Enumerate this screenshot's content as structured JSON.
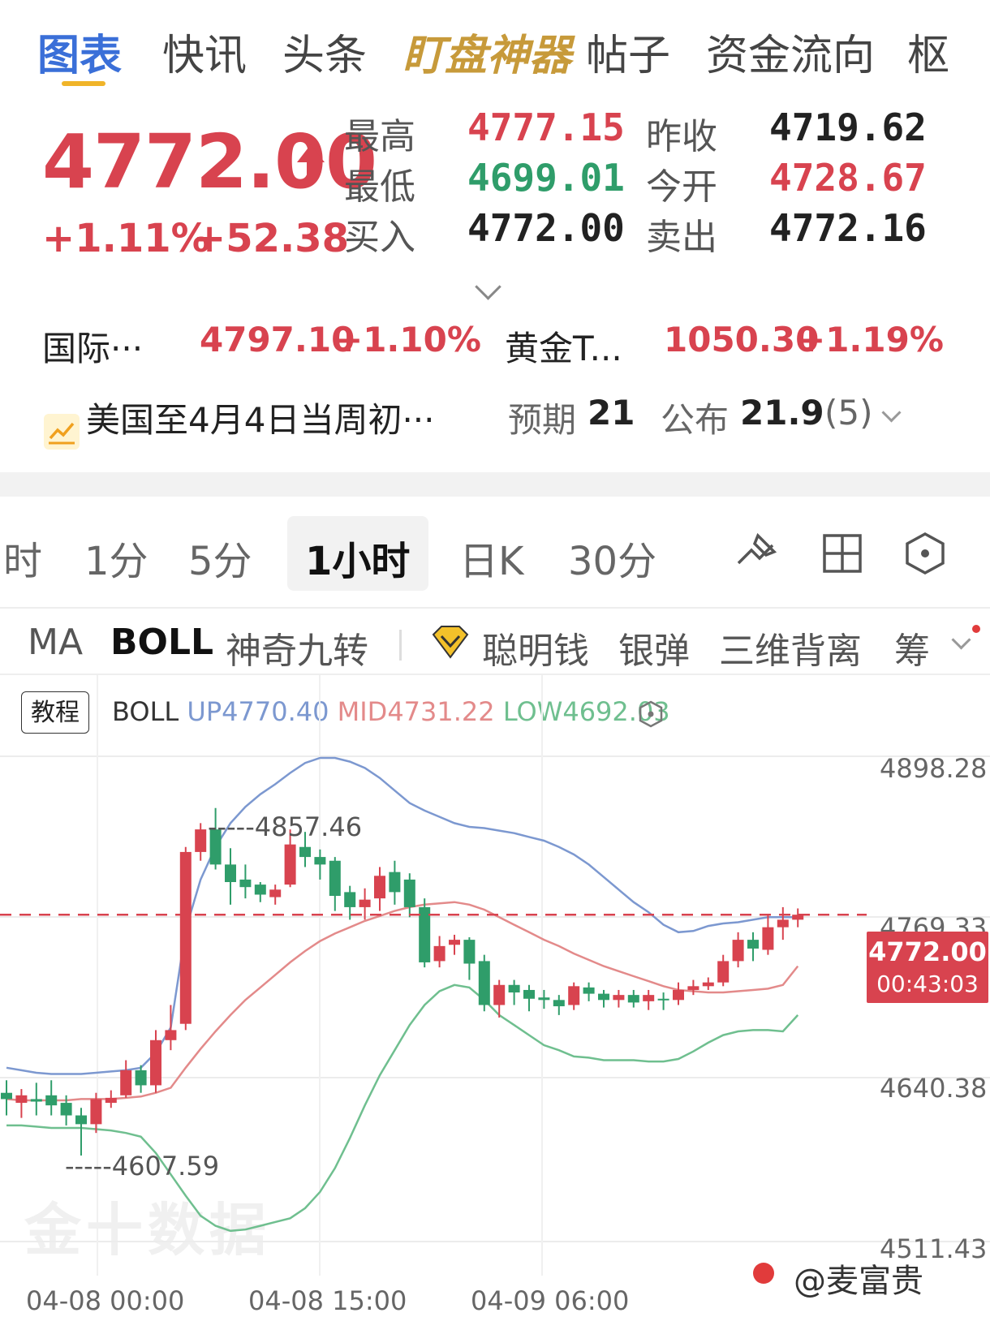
{
  "top_tabs": [
    "图表",
    "快讯",
    "头条",
    "盯盘神器",
    "帖子",
    "资金流向",
    "枢"
  ],
  "quote": {
    "price": "4772.00",
    "pct": "+1.11%",
    "change": "+52.38",
    "high_label": "最高",
    "high": "4777.15",
    "low_label": "最低",
    "low": "4699.01",
    "bid_label": "买入",
    "bid": "4772.00",
    "prev_close_label": "昨收",
    "prev_close": "4719.62",
    "open_label": "今开",
    "open": "4728.67",
    "ask_label": "卖出",
    "ask": "4772.16"
  },
  "related": {
    "a_name": "国际···",
    "a_price": "4797.10",
    "a_pct": "+1.10%",
    "b_name": "黄金T...",
    "b_price": "1050.30",
    "b_pct": "+1.19%"
  },
  "event": {
    "title": "美国至4月4日当周初···",
    "expected_label": "预期",
    "expected": "21",
    "actual_label": "公布",
    "actual": "21.9",
    "count": "(5)"
  },
  "intervals": [
    "时",
    "1分",
    "5分",
    "1小时",
    "日K",
    "30分"
  ],
  "interval_active": "1小时",
  "indicators": [
    "MA",
    "BOLL",
    "神奇九转",
    "聪明钱",
    "银弹",
    "三维背离",
    "筹"
  ],
  "chart": {
    "tutorial": "教程",
    "legend_name": "BOLL",
    "up": "UP4770.40",
    "mid": "MID4731.22",
    "low": "LOW4692.03",
    "y_ticks": [
      "4898.28",
      "4769.33",
      "4640.38",
      "4511.43"
    ],
    "max_label": "4857.46",
    "min_label": "4607.59",
    "current_price": "4772.00",
    "countdown": "00:43:03",
    "x_ticks": [
      "04-08 00:00",
      "04-08 15:00",
      "04-09 06:00"
    ],
    "watermark": "金十数据",
    "credit": "@麦富贵",
    "colors": {
      "up": "#d8434f",
      "down": "#2f9d6a",
      "upper_band": "#7c98d0",
      "mid_band": "#e38a8a",
      "lower_band": "#6fbf8f"
    }
  },
  "chart_data": {
    "type": "candlestick",
    "y_range": [
      4480,
      4930
    ],
    "candles": [
      {
        "o": 4630,
        "c": 4625,
        "h": 4640,
        "l": 4612
      },
      {
        "o": 4622,
        "c": 4628,
        "h": 4633,
        "l": 4610
      },
      {
        "o": 4625,
        "c": 4623,
        "h": 4638,
        "l": 4612
      },
      {
        "o": 4628,
        "c": 4620,
        "h": 4640,
        "l": 4612
      },
      {
        "o": 4622,
        "c": 4612,
        "h": 4628,
        "l": 4604
      },
      {
        "o": 4612,
        "c": 4605,
        "h": 4618,
        "l": 4580
      },
      {
        "o": 4605,
        "c": 4625,
        "h": 4630,
        "l": 4598
      },
      {
        "o": 4622,
        "c": 4626,
        "h": 4632,
        "l": 4618
      },
      {
        "o": 4628,
        "c": 4648,
        "h": 4656,
        "l": 4626
      },
      {
        "o": 4648,
        "c": 4636,
        "h": 4652,
        "l": 4630
      },
      {
        "o": 4636,
        "c": 4672,
        "h": 4680,
        "l": 4630
      },
      {
        "o": 4672,
        "c": 4680,
        "h": 4700,
        "l": 4664
      },
      {
        "o": 4685,
        "c": 4822,
        "h": 4826,
        "l": 4680
      },
      {
        "o": 4822,
        "c": 4840,
        "h": 4845,
        "l": 4815
      },
      {
        "o": 4840,
        "c": 4812,
        "h": 4857,
        "l": 4808
      },
      {
        "o": 4812,
        "c": 4798,
        "h": 4825,
        "l": 4780
      },
      {
        "o": 4800,
        "c": 4794,
        "h": 4812,
        "l": 4785
      },
      {
        "o": 4796,
        "c": 4788,
        "h": 4798,
        "l": 4782
      },
      {
        "o": 4786,
        "c": 4792,
        "h": 4796,
        "l": 4780
      },
      {
        "o": 4796,
        "c": 4828,
        "h": 4840,
        "l": 4794
      },
      {
        "o": 4826,
        "c": 4818,
        "h": 4838,
        "l": 4810
      },
      {
        "o": 4818,
        "c": 4812,
        "h": 4824,
        "l": 4800
      },
      {
        "o": 4815,
        "c": 4787,
        "h": 4818,
        "l": 4775
      },
      {
        "o": 4790,
        "c": 4778,
        "h": 4795,
        "l": 4768
      },
      {
        "o": 4778,
        "c": 4784,
        "h": 4793,
        "l": 4768
      },
      {
        "o": 4785,
        "c": 4803,
        "h": 4810,
        "l": 4775
      },
      {
        "o": 4806,
        "c": 4790,
        "h": 4815,
        "l": 4780
      },
      {
        "o": 4800,
        "c": 4778,
        "h": 4805,
        "l": 4770
      },
      {
        "o": 4778,
        "c": 4734,
        "h": 4785,
        "l": 4730
      },
      {
        "o": 4735,
        "c": 4747,
        "h": 4755,
        "l": 4730
      },
      {
        "o": 4748,
        "c": 4752,
        "h": 4756,
        "l": 4740
      },
      {
        "o": 4752,
        "c": 4733,
        "h": 4754,
        "l": 4720
      },
      {
        "o": 4735,
        "c": 4700,
        "h": 4740,
        "l": 4695
      },
      {
        "o": 4700,
        "c": 4716,
        "h": 4720,
        "l": 4690
      },
      {
        "o": 4716,
        "c": 4710,
        "h": 4720,
        "l": 4700
      },
      {
        "o": 4712,
        "c": 4705,
        "h": 4716,
        "l": 4695
      },
      {
        "o": 4706,
        "c": 4704,
        "h": 4712,
        "l": 4697
      },
      {
        "o": 4704,
        "c": 4699,
        "h": 4708,
        "l": 4692
      },
      {
        "o": 4700,
        "c": 4715,
        "h": 4718,
        "l": 4696
      },
      {
        "o": 4714,
        "c": 4709,
        "h": 4718,
        "l": 4703
      },
      {
        "o": 4709,
        "c": 4704,
        "h": 4712,
        "l": 4698
      },
      {
        "o": 4704,
        "c": 4708,
        "h": 4712,
        "l": 4698
      },
      {
        "o": 4708,
        "c": 4702,
        "h": 4712,
        "l": 4698
      },
      {
        "o": 4703,
        "c": 4708,
        "h": 4712,
        "l": 4696
      },
      {
        "o": 4705,
        "c": 4704,
        "h": 4710,
        "l": 4696
      },
      {
        "o": 4704,
        "c": 4712,
        "h": 4718,
        "l": 4700
      },
      {
        "o": 4712,
        "c": 4715,
        "h": 4720,
        "l": 4708
      },
      {
        "o": 4715,
        "c": 4718,
        "h": 4722,
        "l": 4712
      },
      {
        "o": 4718,
        "c": 4735,
        "h": 4740,
        "l": 4715
      },
      {
        "o": 4735,
        "c": 4752,
        "h": 4758,
        "l": 4730
      },
      {
        "o": 4752,
        "c": 4745,
        "h": 4758,
        "l": 4735
      },
      {
        "o": 4744,
        "c": 4762,
        "h": 4772,
        "l": 4740
      },
      {
        "o": 4762,
        "c": 4768,
        "h": 4778,
        "l": 4752
      },
      {
        "o": 4768,
        "c": 4772,
        "h": 4777,
        "l": 4762
      }
    ],
    "upper_band": [
      4650,
      4648,
      4646,
      4645,
      4645,
      4645,
      4646,
      4647,
      4648,
      4650,
      4662,
      4682,
      4760,
      4800,
      4826,
      4845,
      4858,
      4868,
      4876,
      4885,
      4893,
      4897,
      4897,
      4894,
      4889,
      4881,
      4871,
      4861,
      4855,
      4850,
      4845,
      4842,
      4841,
      4839,
      4837,
      4834,
      4831,
      4826,
      4820,
      4812,
      4802,
      4792,
      4782,
      4774,
      4764,
      4758,
      4759,
      4763,
      4765,
      4766,
      4768,
      4770,
      4770,
      4770
    ],
    "mid_band": [
      4625,
      4624,
      4624,
      4624,
      4624,
      4625,
      4625,
      4625,
      4626,
      4627,
      4630,
      4634,
      4650,
      4665,
      4679,
      4692,
      4704,
      4714,
      4724,
      4734,
      4743,
      4751,
      4757,
      4762,
      4767,
      4771,
      4775,
      4778,
      4780,
      4781,
      4782,
      4780,
      4776,
      4770,
      4764,
      4758,
      4752,
      4747,
      4741,
      4736,
      4731,
      4727,
      4723,
      4719,
      4715,
      4712,
      4711,
      4710,
      4710,
      4711,
      4712,
      4713,
      4716,
      4731
    ],
    "lower_band": [
      4604,
      4604,
      4603,
      4602,
      4602,
      4602,
      4601,
      4600,
      4598,
      4595,
      4582,
      4565,
      4548,
      4532,
      4524,
      4520,
      4521,
      4524,
      4527,
      4530,
      4538,
      4551,
      4570,
      4594,
      4620,
      4644,
      4664,
      4684,
      4700,
      4711,
      4716,
      4714,
      4704,
      4692,
      4684,
      4676,
      4668,
      4664,
      4659,
      4658,
      4656,
      4656,
      4656,
      4655,
      4655,
      4657,
      4663,
      4670,
      4676,
      4679,
      4680,
      4680,
      4679,
      4692
    ]
  }
}
